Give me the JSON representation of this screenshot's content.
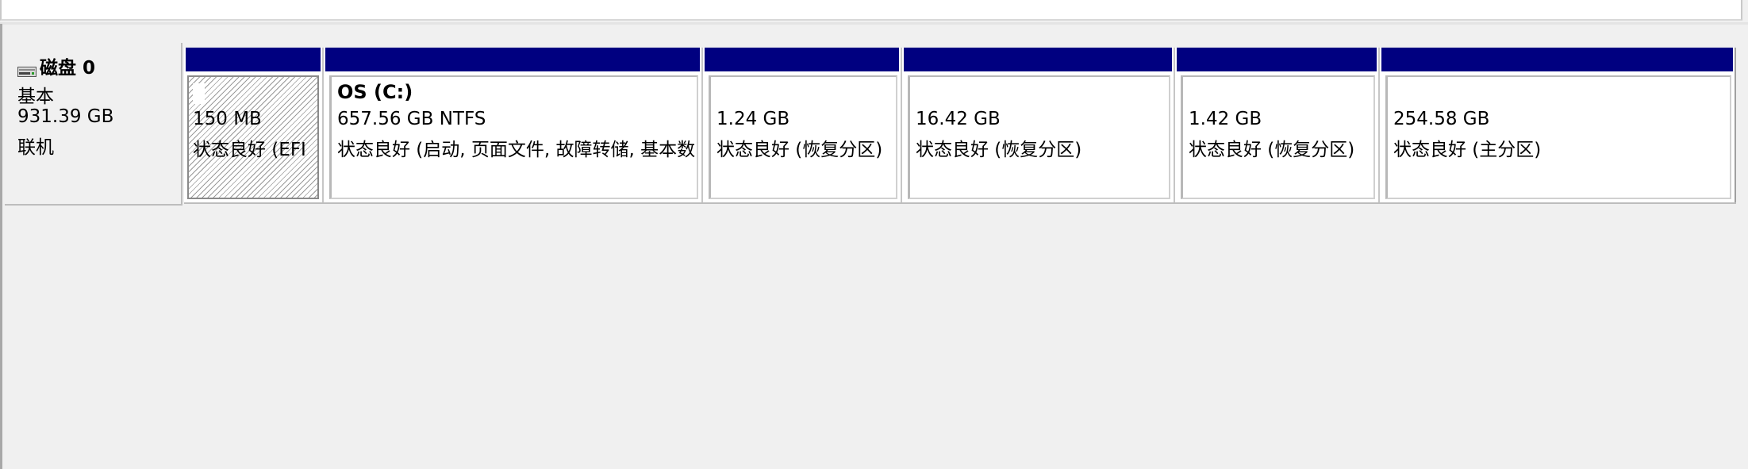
{
  "disk": {
    "title": "磁盘 0",
    "type": "基本",
    "capacity": "931.39 GB",
    "status": "联机",
    "icon": "disk-drive-icon"
  },
  "partitions": [
    {
      "name": "",
      "size": "150 MB",
      "status": "状态良好 (EFI",
      "style": "hatched"
    },
    {
      "name": "OS  (C:)",
      "size": "657.56 GB NTFS",
      "status": "状态良好 (启动, 页面文件, 故障转储, 基本数",
      "style": "primary"
    },
    {
      "name": "",
      "size": "1.24 GB",
      "status": "状态良好 (恢复分区)",
      "style": "primary"
    },
    {
      "name": "",
      "size": "16.42 GB",
      "status": "状态良好 (恢复分区)",
      "style": "primary"
    },
    {
      "name": "",
      "size": "1.42 GB",
      "status": "状态良好 (恢复分区)",
      "style": "primary"
    },
    {
      "name": "",
      "size": "254.58 GB",
      "status": "状态良好 (主分区)",
      "style": "primary"
    }
  ],
  "colors": {
    "partition_bar": "#000080",
    "background": "#f0f0f0"
  }
}
